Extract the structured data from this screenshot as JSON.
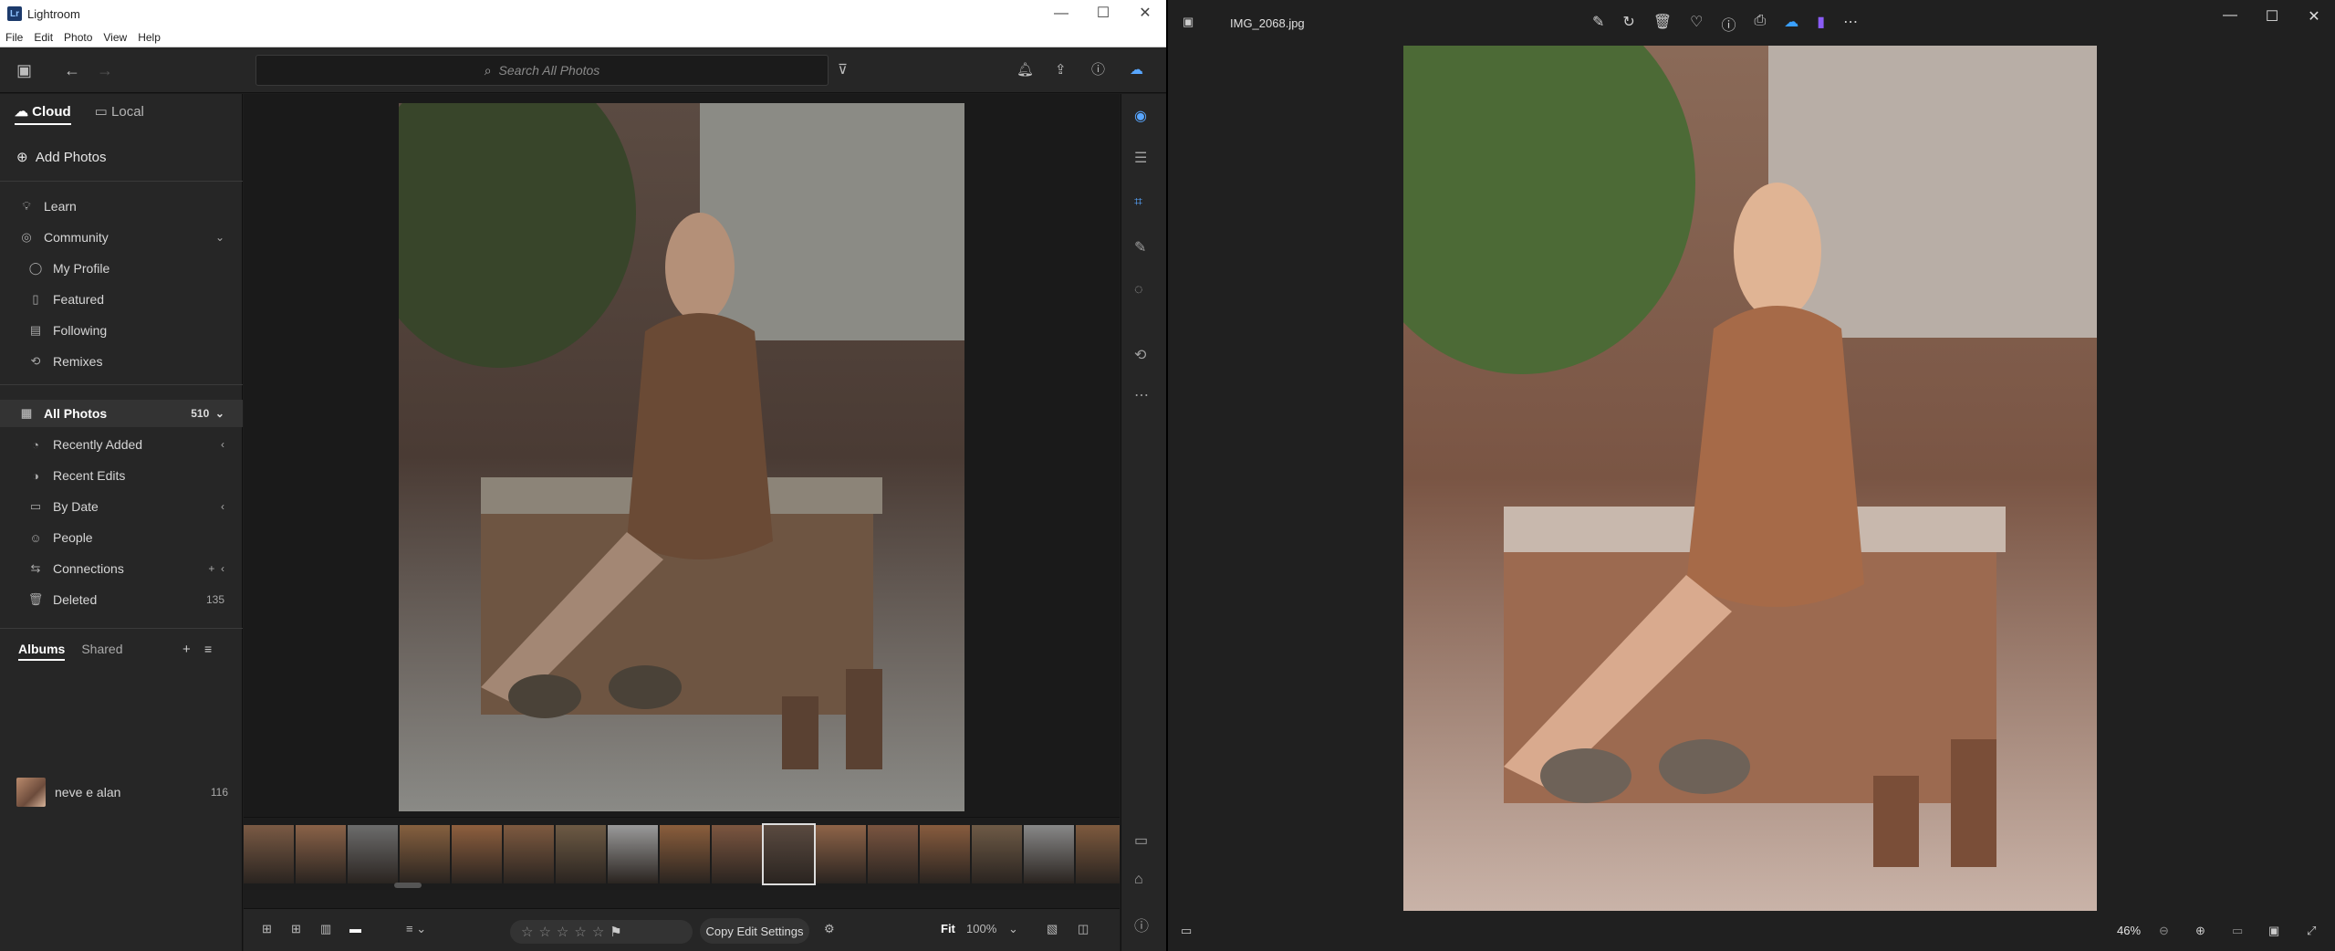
{
  "lightroom": {
    "title": "Lightroom",
    "window_controls": [
      "—",
      "☐",
      "✕"
    ],
    "menu": [
      "File",
      "Edit",
      "Photo",
      "View",
      "Help"
    ],
    "search_placeholder": "Search All Photos",
    "tabs": {
      "cloud": "Cloud",
      "local": "Local"
    },
    "add_photos": "Add Photos",
    "nav": {
      "learn": "Learn",
      "community": "Community",
      "my_profile": "My Profile",
      "featured": "Featured",
      "following": "Following",
      "remixes": "Remixes",
      "all_photos": "All Photos",
      "all_photos_count": "510",
      "recently_added": "Recently Added",
      "recent_edits": "Recent Edits",
      "by_date": "By Date",
      "people": "People",
      "connections": "Connections",
      "deleted": "Deleted",
      "deleted_count": "135"
    },
    "albums_tabs": {
      "albums": "Albums",
      "shared": "Shared"
    },
    "album": {
      "name": "neve e alan",
      "count": "116"
    },
    "bottom": {
      "copy_edit_settings": "Copy Edit Settings",
      "fit": "Fit",
      "zoom": "100%"
    }
  },
  "photos": {
    "filename": "IMG_2068.jpg",
    "zoom": "46%",
    "window_controls": [
      "—",
      "☐",
      "✕"
    ]
  }
}
